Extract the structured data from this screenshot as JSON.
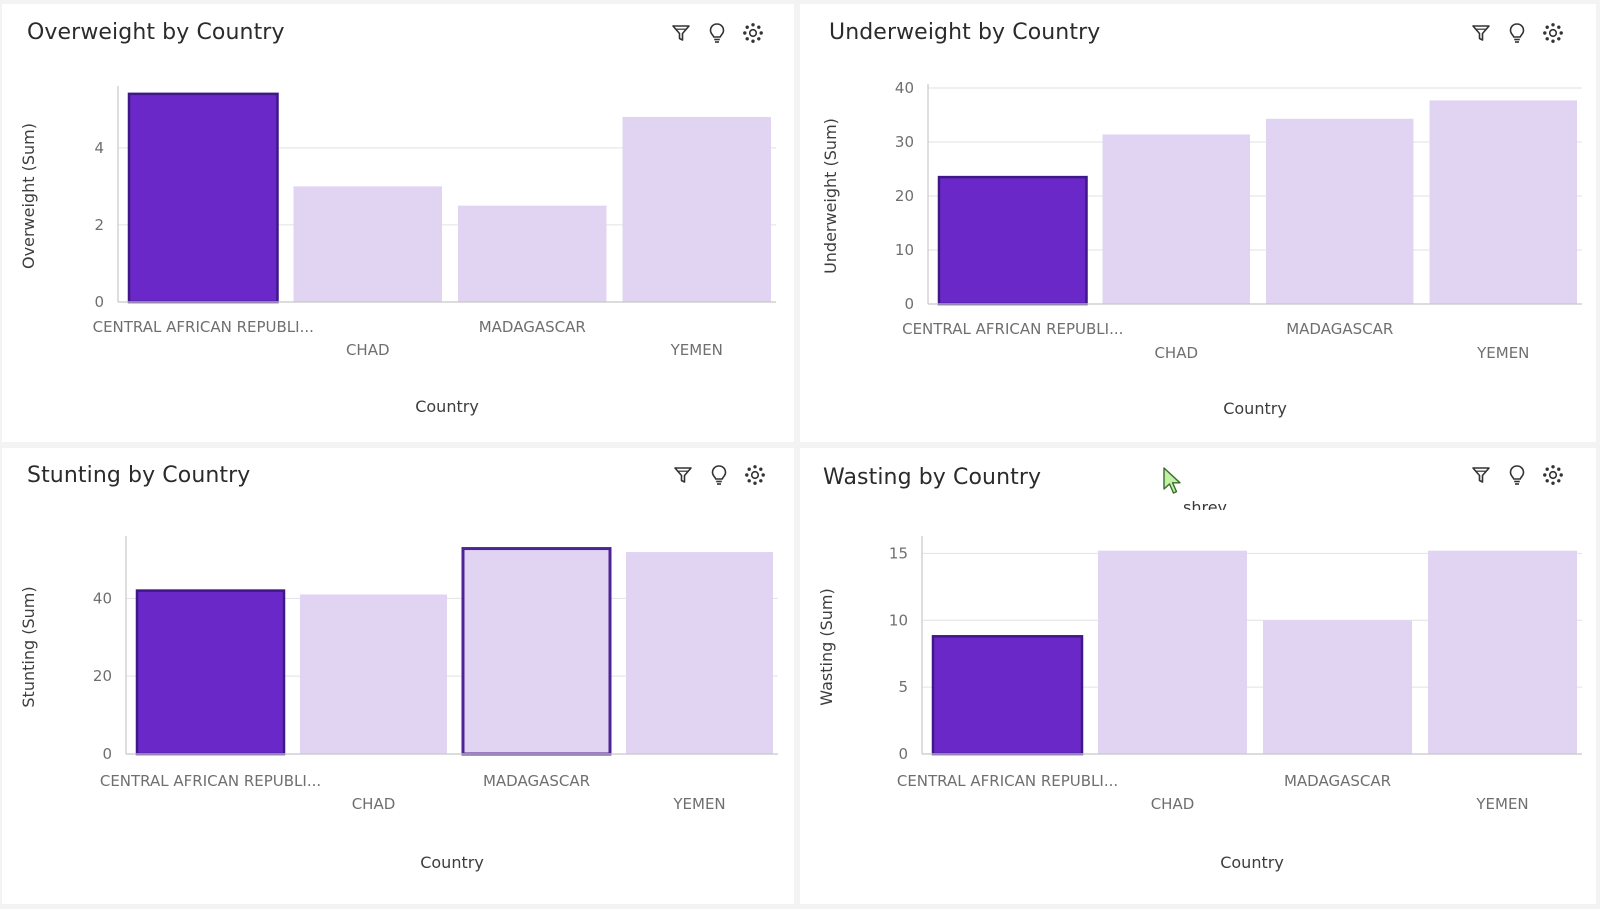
{
  "colors": {
    "selected_fill": "#6a28c9",
    "selected_stroke": "#3f1787",
    "bar_fill": "#e1d4f3",
    "outline_stroke": "#4e2395"
  },
  "icons": [
    "filter-icon",
    "lightbulb-icon",
    "settings-icon"
  ],
  "cursor_label": "shrey",
  "chart_data": [
    {
      "type": "bar",
      "title": "Overweight by Country",
      "xlabel": "Country",
      "ylabel": "Overweight (Sum)",
      "categories": [
        "CENTRAL AFRICAN REPUBLI...",
        "CHAD",
        "MADAGASCAR",
        "YEMEN"
      ],
      "values": [
        5.4,
        3.0,
        2.5,
        4.8
      ],
      "ylim": [
        0,
        5.5
      ],
      "yticks": [
        0,
        2,
        4
      ],
      "grid": true,
      "legend": "none",
      "selected": [
        0
      ],
      "outlined": []
    },
    {
      "type": "bar",
      "title": "Underweight by Country",
      "xlabel": "Country",
      "ylabel": "Underweight (Sum)",
      "categories": [
        "CENTRAL AFRICAN REPUBLI...",
        "CHAD",
        "MADAGASCAR",
        "YEMEN"
      ],
      "values": [
        23.5,
        31.4,
        34.3,
        37.7
      ],
      "ylim": [
        0,
        40
      ],
      "yticks": [
        0,
        10,
        20,
        30,
        40
      ],
      "grid": true,
      "legend": "none",
      "selected": [
        0
      ],
      "outlined": []
    },
    {
      "type": "bar",
      "title": "Stunting by Country",
      "xlabel": "Country",
      "ylabel": "Stunting (Sum)",
      "categories": [
        "CENTRAL AFRICAN REPUBLI...",
        "CHAD",
        "MADAGASCAR",
        "YEMEN"
      ],
      "values": [
        42.0,
        41.0,
        52.8,
        51.9
      ],
      "ylim": [
        0,
        55
      ],
      "yticks": [
        0,
        20,
        40
      ],
      "grid": true,
      "legend": "none",
      "selected": [
        0
      ],
      "outlined": [
        2
      ]
    },
    {
      "type": "bar",
      "title": "Wasting by Country",
      "xlabel": "Country",
      "ylabel": "Wasting (Sum)",
      "categories": [
        "CENTRAL AFRICAN REPUBLI...",
        "CHAD",
        "MADAGASCAR",
        "YEMEN"
      ],
      "values": [
        8.8,
        15.2,
        10.0,
        15.2
      ],
      "ylim": [
        0,
        16
      ],
      "yticks": [
        0,
        5,
        10,
        15
      ],
      "grid": true,
      "legend": "none",
      "selected": [
        0
      ],
      "outlined": []
    }
  ]
}
